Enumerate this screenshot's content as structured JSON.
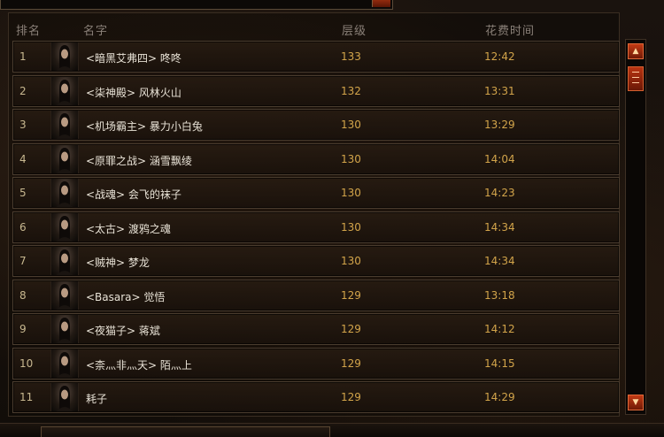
{
  "header": {
    "rank": "排名",
    "name": "名字",
    "level": "层级",
    "time": "花费时间"
  },
  "rows": [
    {
      "rank": "1",
      "name": "<暗黑艾弗四> 咚咚",
      "level": "133",
      "time": "12:42"
    },
    {
      "rank": "2",
      "name": "<柒神殿> 风林火山",
      "level": "132",
      "time": "13:31"
    },
    {
      "rank": "3",
      "name": "<机场霸主> 暴力小白兔",
      "level": "130",
      "time": "13:29"
    },
    {
      "rank": "4",
      "name": "<原罪之战> 涵雪飘绫",
      "level": "130",
      "time": "14:04"
    },
    {
      "rank": "5",
      "name": "<战魂> 会飞的袜子",
      "level": "130",
      "time": "14:23"
    },
    {
      "rank": "6",
      "name": "<太古> 渡鸦之魂",
      "level": "130",
      "time": "14:34"
    },
    {
      "rank": "7",
      "name": "<贼神> 梦龙",
      "level": "130",
      "time": "14:34"
    },
    {
      "rank": "8",
      "name": "<Basara> 觉悟",
      "level": "129",
      "time": "13:18"
    },
    {
      "rank": "9",
      "name": "<夜猫子> 蒋斌",
      "level": "129",
      "time": "14:12"
    },
    {
      "rank": "10",
      "name": "<柰灬非灬天> 陌灬上",
      "level": "129",
      "time": "14:15"
    },
    {
      "rank": "11",
      "name": "耗子",
      "level": "129",
      "time": "14:29"
    }
  ],
  "icons": {
    "scroll_up": "▲",
    "scroll_down": "▼"
  },
  "colors": {
    "level_time": "#d2a44a",
    "name": "#e8e2d6",
    "scroll_accent": "#c23a14"
  }
}
